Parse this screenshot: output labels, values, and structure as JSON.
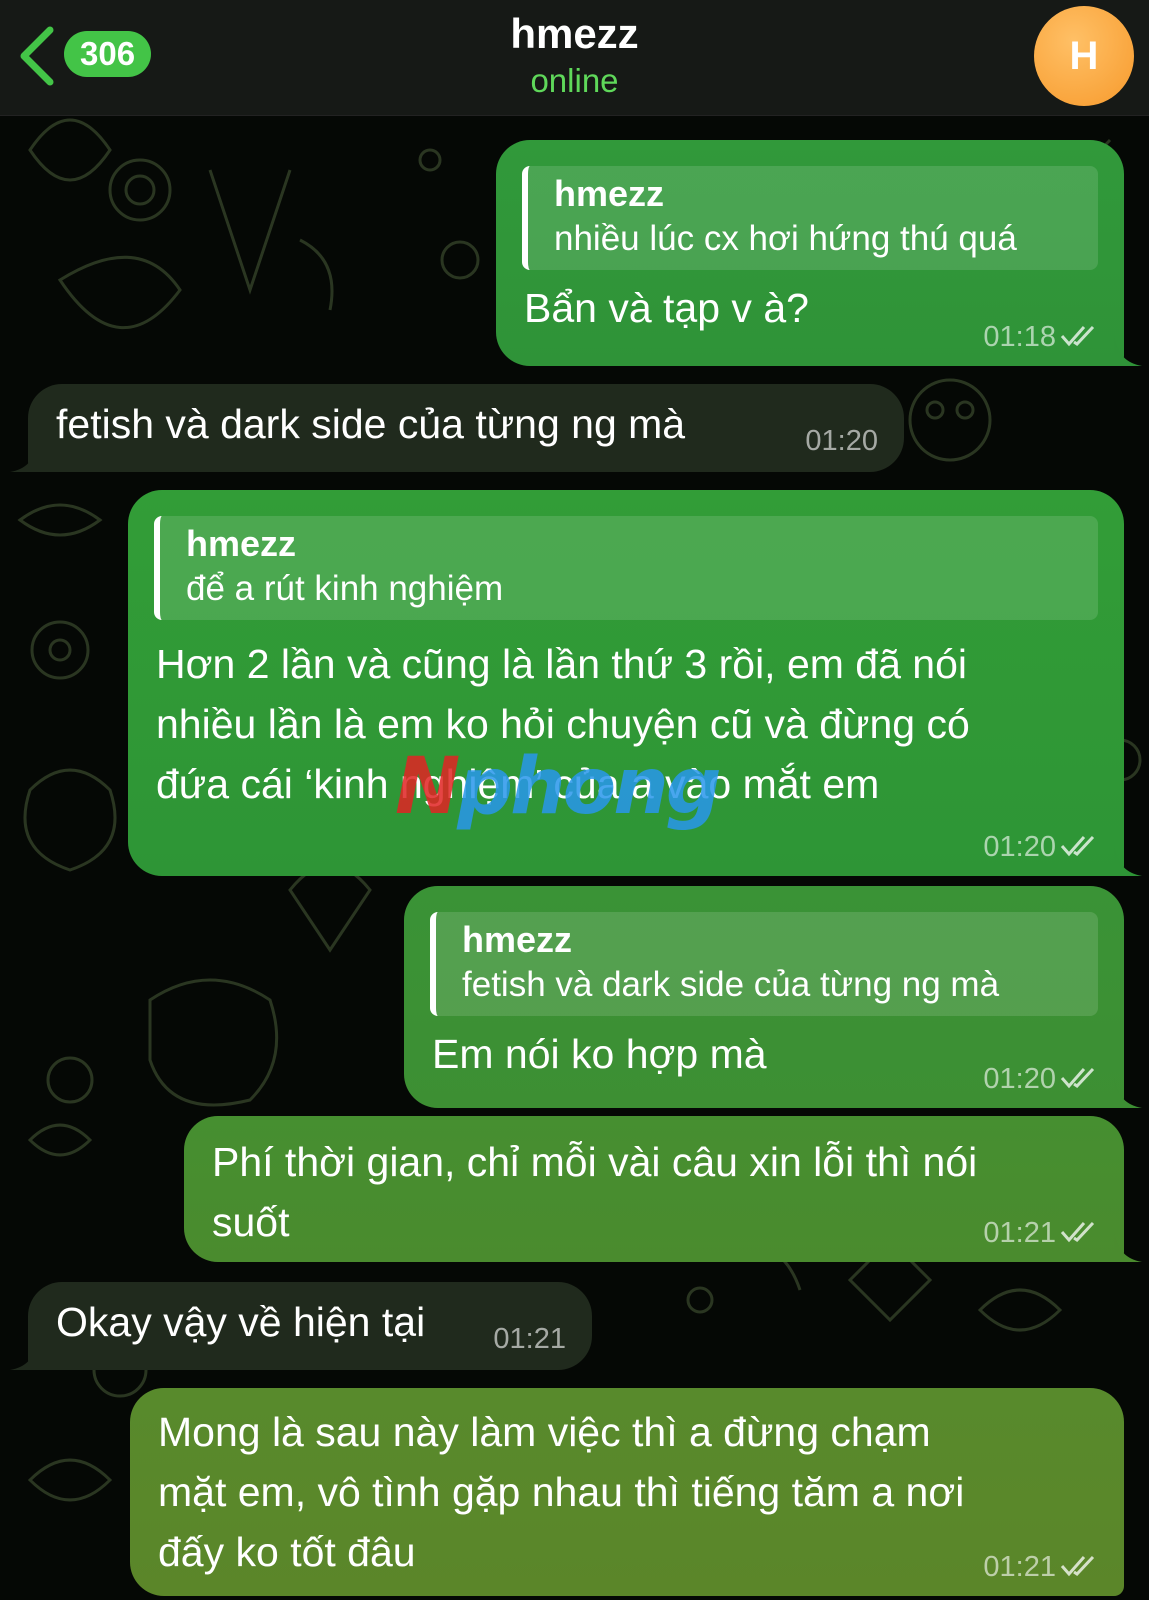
{
  "header": {
    "back_count": "306",
    "title": "hmezz",
    "status": "online",
    "avatar_letter": "H"
  },
  "messages": [
    {
      "reply_name": "hmezz",
      "reply_text": "nhiều lúc cx hơi hứng thú quá",
      "text": "Bẩn và tạp v à?",
      "time": "01:18"
    },
    {
      "text": "fetish và dark side của từng ng mà",
      "time": "01:20"
    },
    {
      "reply_name": "hmezz",
      "reply_text": "để a rút kinh nghiệm",
      "lines": [
        "Hơn 2 lần và cũng là lần thứ 3 rồi, em đã nói",
        "nhiều lần là em ko hỏi chuyện cũ và đừng có",
        "đứa cái ‘kinh nghiệm’ của a vào mắt em"
      ],
      "time": "01:20"
    },
    {
      "reply_name": "hmezz",
      "reply_text": "fetish và dark side của từng ng mà",
      "text": "Em nói ko hợp mà",
      "time": "01:20"
    },
    {
      "lines": [
        "Phí thời gian, chỉ mỗi vài câu xin lỗi thì nói",
        "suốt"
      ],
      "time": "01:21"
    },
    {
      "text": "Okay vậy về hiện tại",
      "time": "01:21"
    },
    {
      "lines": [
        "Mong là sau này làm việc thì a đừng chạm",
        "mặt em, vô tình gặp nhau thì tiếng tăm a nơi",
        "đấy ko tốt đâu"
      ],
      "time": "01:21"
    }
  ],
  "watermark": {
    "part1": "N",
    "part2": "phong"
  },
  "colors": {
    "outgoing_top": "#2f9a35",
    "outgoing_bottom": "#5a8a2a",
    "incoming": "#202a1d",
    "accent": "#43c447",
    "avatar": "#f79a2c"
  },
  "icons": [
    "back-chevron-icon",
    "read-checkmarks-icon"
  ]
}
